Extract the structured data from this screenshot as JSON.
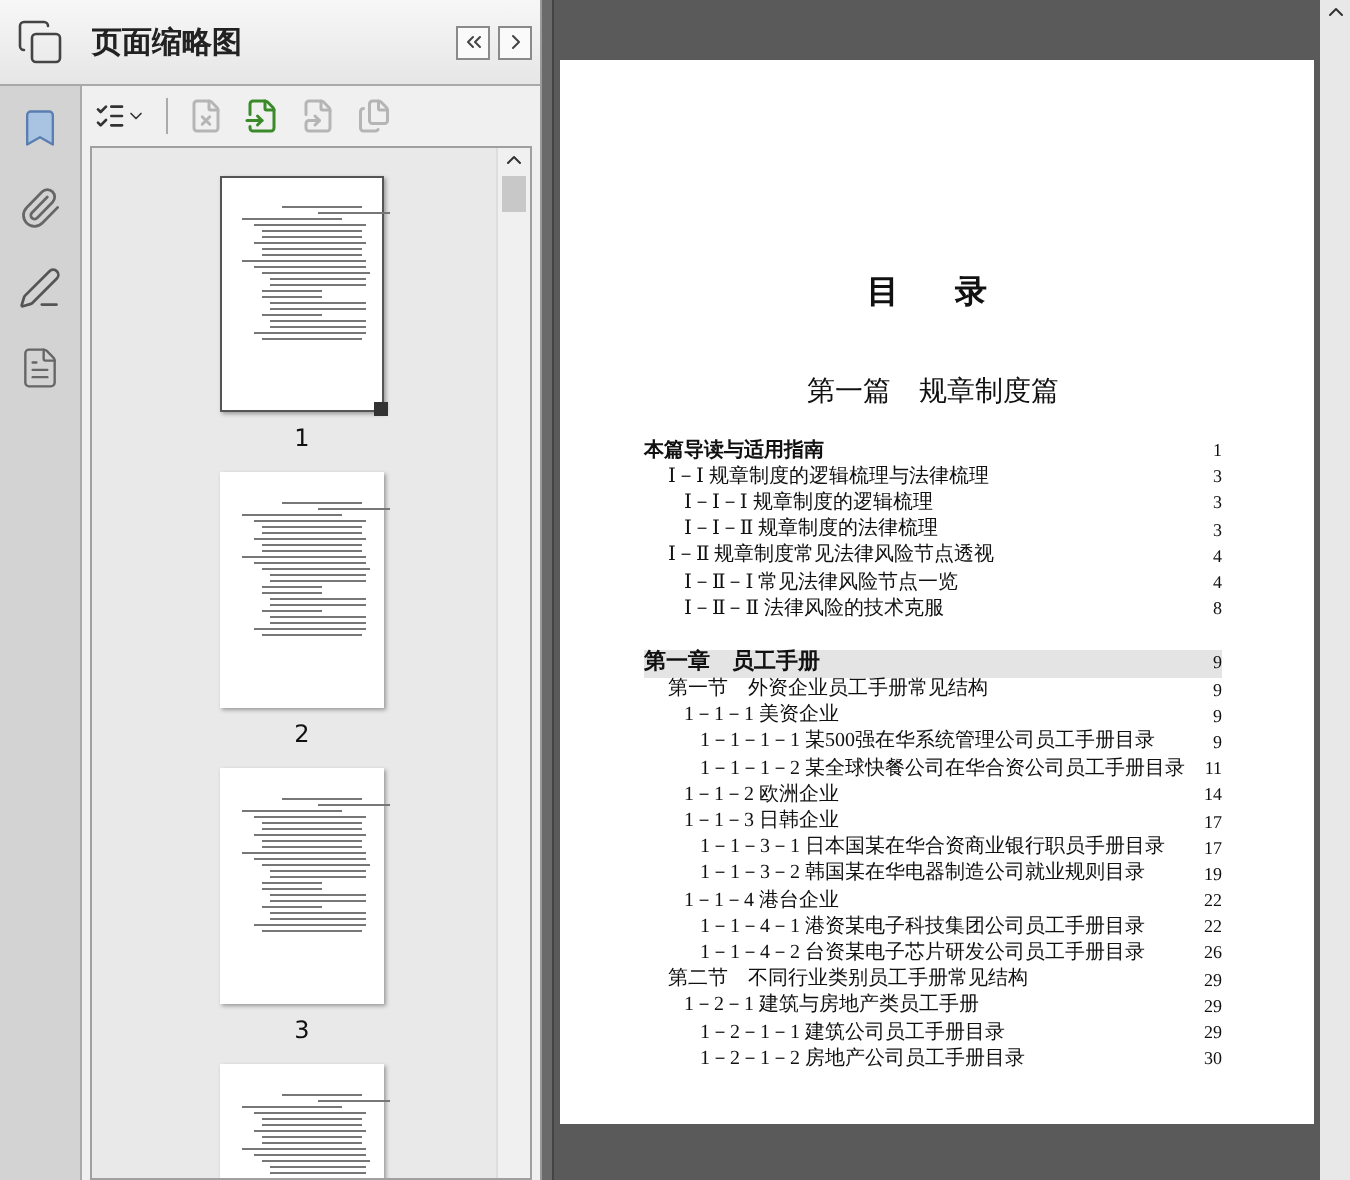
{
  "panel": {
    "title": "页面缩略图"
  },
  "thumbnails": [
    {
      "label": "1",
      "selected": true
    },
    {
      "label": "2",
      "selected": false
    },
    {
      "label": "3",
      "selected": false
    },
    {
      "selected": false
    }
  ],
  "page": {
    "title": "目　录",
    "part_title": "第一篇　规章制度篇",
    "toc": [
      {
        "kind": "guide",
        "text": "本篇导读与适用指南",
        "page": "1",
        "children": [
          {
            "text": "Ⅰ－Ⅰ 规章制度的逻辑梳理与法律梳理",
            "page": "3",
            "children": [
              {
                "text": "Ⅰ－Ⅰ－Ⅰ 规章制度的逻辑梳理",
                "page": "3"
              },
              {
                "text": "Ⅰ－Ⅰ－Ⅱ 规章制度的法律梳理",
                "page": "3"
              }
            ]
          },
          {
            "text": "Ⅰ－Ⅱ 规章制度常见法律风险节点透视",
            "page": "4",
            "children": [
              {
                "text": "Ⅰ－Ⅱ－Ⅰ 常见法律风险节点一览",
                "page": "4"
              },
              {
                "text": "Ⅰ－Ⅱ－Ⅱ 法律风险的技术克服",
                "page": "8"
              }
            ]
          }
        ]
      },
      {
        "kind": "chapter",
        "text": "第一章　员工手册",
        "page": "9",
        "children": [
          {
            "text": "第一节　外资企业员工手册常见结构",
            "page": "9",
            "children": [
              {
                "text": "1－1－1 美资企业",
                "page": "9",
                "children": [
                  {
                    "text": "1－1－1－1 某500强在华系统管理公司员工手册目录",
                    "page": "9"
                  },
                  {
                    "text": "1－1－1－2 某全球快餐公司在华合资公司员工手册目录",
                    "page": "11"
                  }
                ]
              },
              {
                "text": "1－1－2 欧洲企业",
                "page": "14"
              },
              {
                "text": "1－1－3 日韩企业",
                "page": "17",
                "children": [
                  {
                    "text": "1－1－3－1 日本国某在华合资商业银行职员手册目录",
                    "page": "17"
                  },
                  {
                    "text": "1－1－3－2 韩国某在华电器制造公司就业规则目录",
                    "page": "19"
                  }
                ]
              },
              {
                "text": "1－1－4 港台企业",
                "page": "22",
                "children": [
                  {
                    "text": "1－1－4－1 港资某电子科技集团公司员工手册目录",
                    "page": "22"
                  },
                  {
                    "text": "1－1－4－2 台资某电子芯片研发公司员工手册目录",
                    "page": "26"
                  }
                ]
              }
            ]
          },
          {
            "text": "第二节　不同行业类别员工手册常见结构",
            "page": "29",
            "children": [
              {
                "text": "1－2－1 建筑与房地产类员工手册",
                "page": "29",
                "children": [
                  {
                    "text": "1－2－1－1 建筑公司员工手册目录",
                    "page": "29"
                  },
                  {
                    "text": "1－2－1－2 房地产公司员工手册目录",
                    "page": "30"
                  }
                ]
              }
            ]
          }
        ]
      }
    ]
  }
}
